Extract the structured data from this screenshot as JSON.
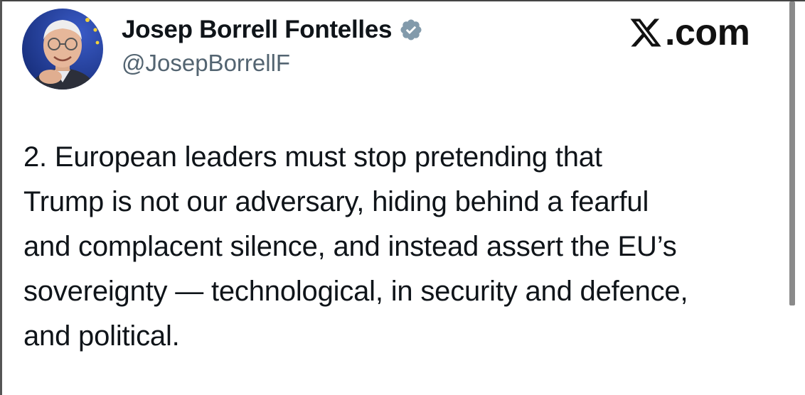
{
  "author": {
    "display_name": "Josep Borrell Fontelles",
    "handle": "@JosepBorrellF",
    "verified": true,
    "verified_badge_color": "#829aab",
    "avatar_icon": "profile-photo"
  },
  "brand": {
    "label": ".com",
    "logo_icon": "x-logo-icon"
  },
  "tweet": {
    "text": "2. European leaders must stop pretending that\nTrump is not our adversary, hiding behind a fearful\nand complacent silence, and instead assert the EU’s\nsovereignty — technological, in security and defence,\nand political."
  },
  "colors": {
    "text": "#0f1419",
    "secondary_text": "#536471",
    "background": "#ffffff",
    "eu_blue": "#1f3f9a"
  }
}
